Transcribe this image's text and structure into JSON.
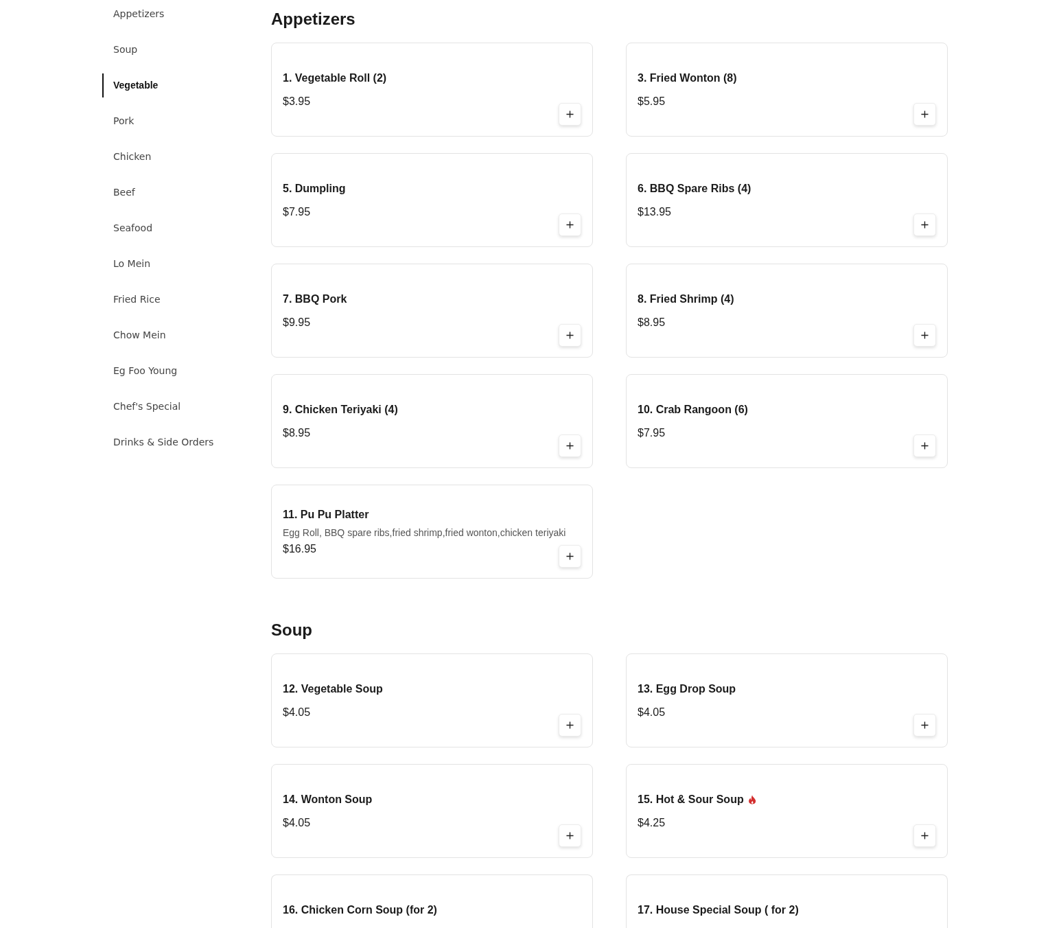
{
  "sidebar": {
    "items": [
      {
        "label": "Appetizers",
        "selected": false
      },
      {
        "label": "Soup",
        "selected": false
      },
      {
        "label": "Vegetable",
        "selected": true
      },
      {
        "label": "Pork",
        "selected": false
      },
      {
        "label": "Chicken",
        "selected": false
      },
      {
        "label": "Beef",
        "selected": false
      },
      {
        "label": "Seafood",
        "selected": false
      },
      {
        "label": "Lo Mein",
        "selected": false
      },
      {
        "label": "Fried Rice",
        "selected": false
      },
      {
        "label": "Chow Mein",
        "selected": false
      },
      {
        "label": "Eg Foo Young",
        "selected": false
      },
      {
        "label": "Chef's Special",
        "selected": false
      },
      {
        "label": "Drinks & Side Orders",
        "selected": false
      }
    ]
  },
  "sections": [
    {
      "heading": "Appetizers",
      "items": [
        {
          "title": "1. Vegetable Roll (2)",
          "price": "$3.95",
          "spicy": false
        },
        {
          "title": "3. Fried Wonton (8)",
          "price": "$5.95",
          "spicy": false
        },
        {
          "title": "5. Dumpling",
          "price": "$7.95",
          "spicy": false
        },
        {
          "title": "6. BBQ Spare Ribs (4)",
          "price": "$13.95",
          "spicy": false
        },
        {
          "title": "7. BBQ Pork",
          "price": "$9.95",
          "spicy": false
        },
        {
          "title": "8. Fried Shrimp (4)",
          "price": "$8.95",
          "spicy": false
        },
        {
          "title": "9. Chicken Teriyaki (4)",
          "price": "$8.95",
          "spicy": false
        },
        {
          "title": "10. Crab Rangoon (6)",
          "price": "$7.95",
          "spicy": false
        },
        {
          "title": "11. Pu Pu Platter",
          "description": "Egg Roll, BBQ spare ribs,fried shrimp,fried wonton,chicken teriyaki",
          "price": "$16.95",
          "spicy": false
        }
      ]
    },
    {
      "heading": "Soup",
      "items": [
        {
          "title": "12. Vegetable Soup",
          "price": "$4.05",
          "spicy": false
        },
        {
          "title": "13. Egg Drop Soup",
          "price": "$4.05",
          "spicy": false
        },
        {
          "title": "14. Wonton Soup",
          "price": "$4.05",
          "spicy": false
        },
        {
          "title": "15. Hot & Sour Soup",
          "price": "$4.25",
          "spicy": true
        },
        {
          "title": "16. Chicken Corn Soup (for 2)",
          "spicy": false
        },
        {
          "title": "17. House Special Soup ( for 2)",
          "spicy": false
        }
      ]
    }
  ]
}
